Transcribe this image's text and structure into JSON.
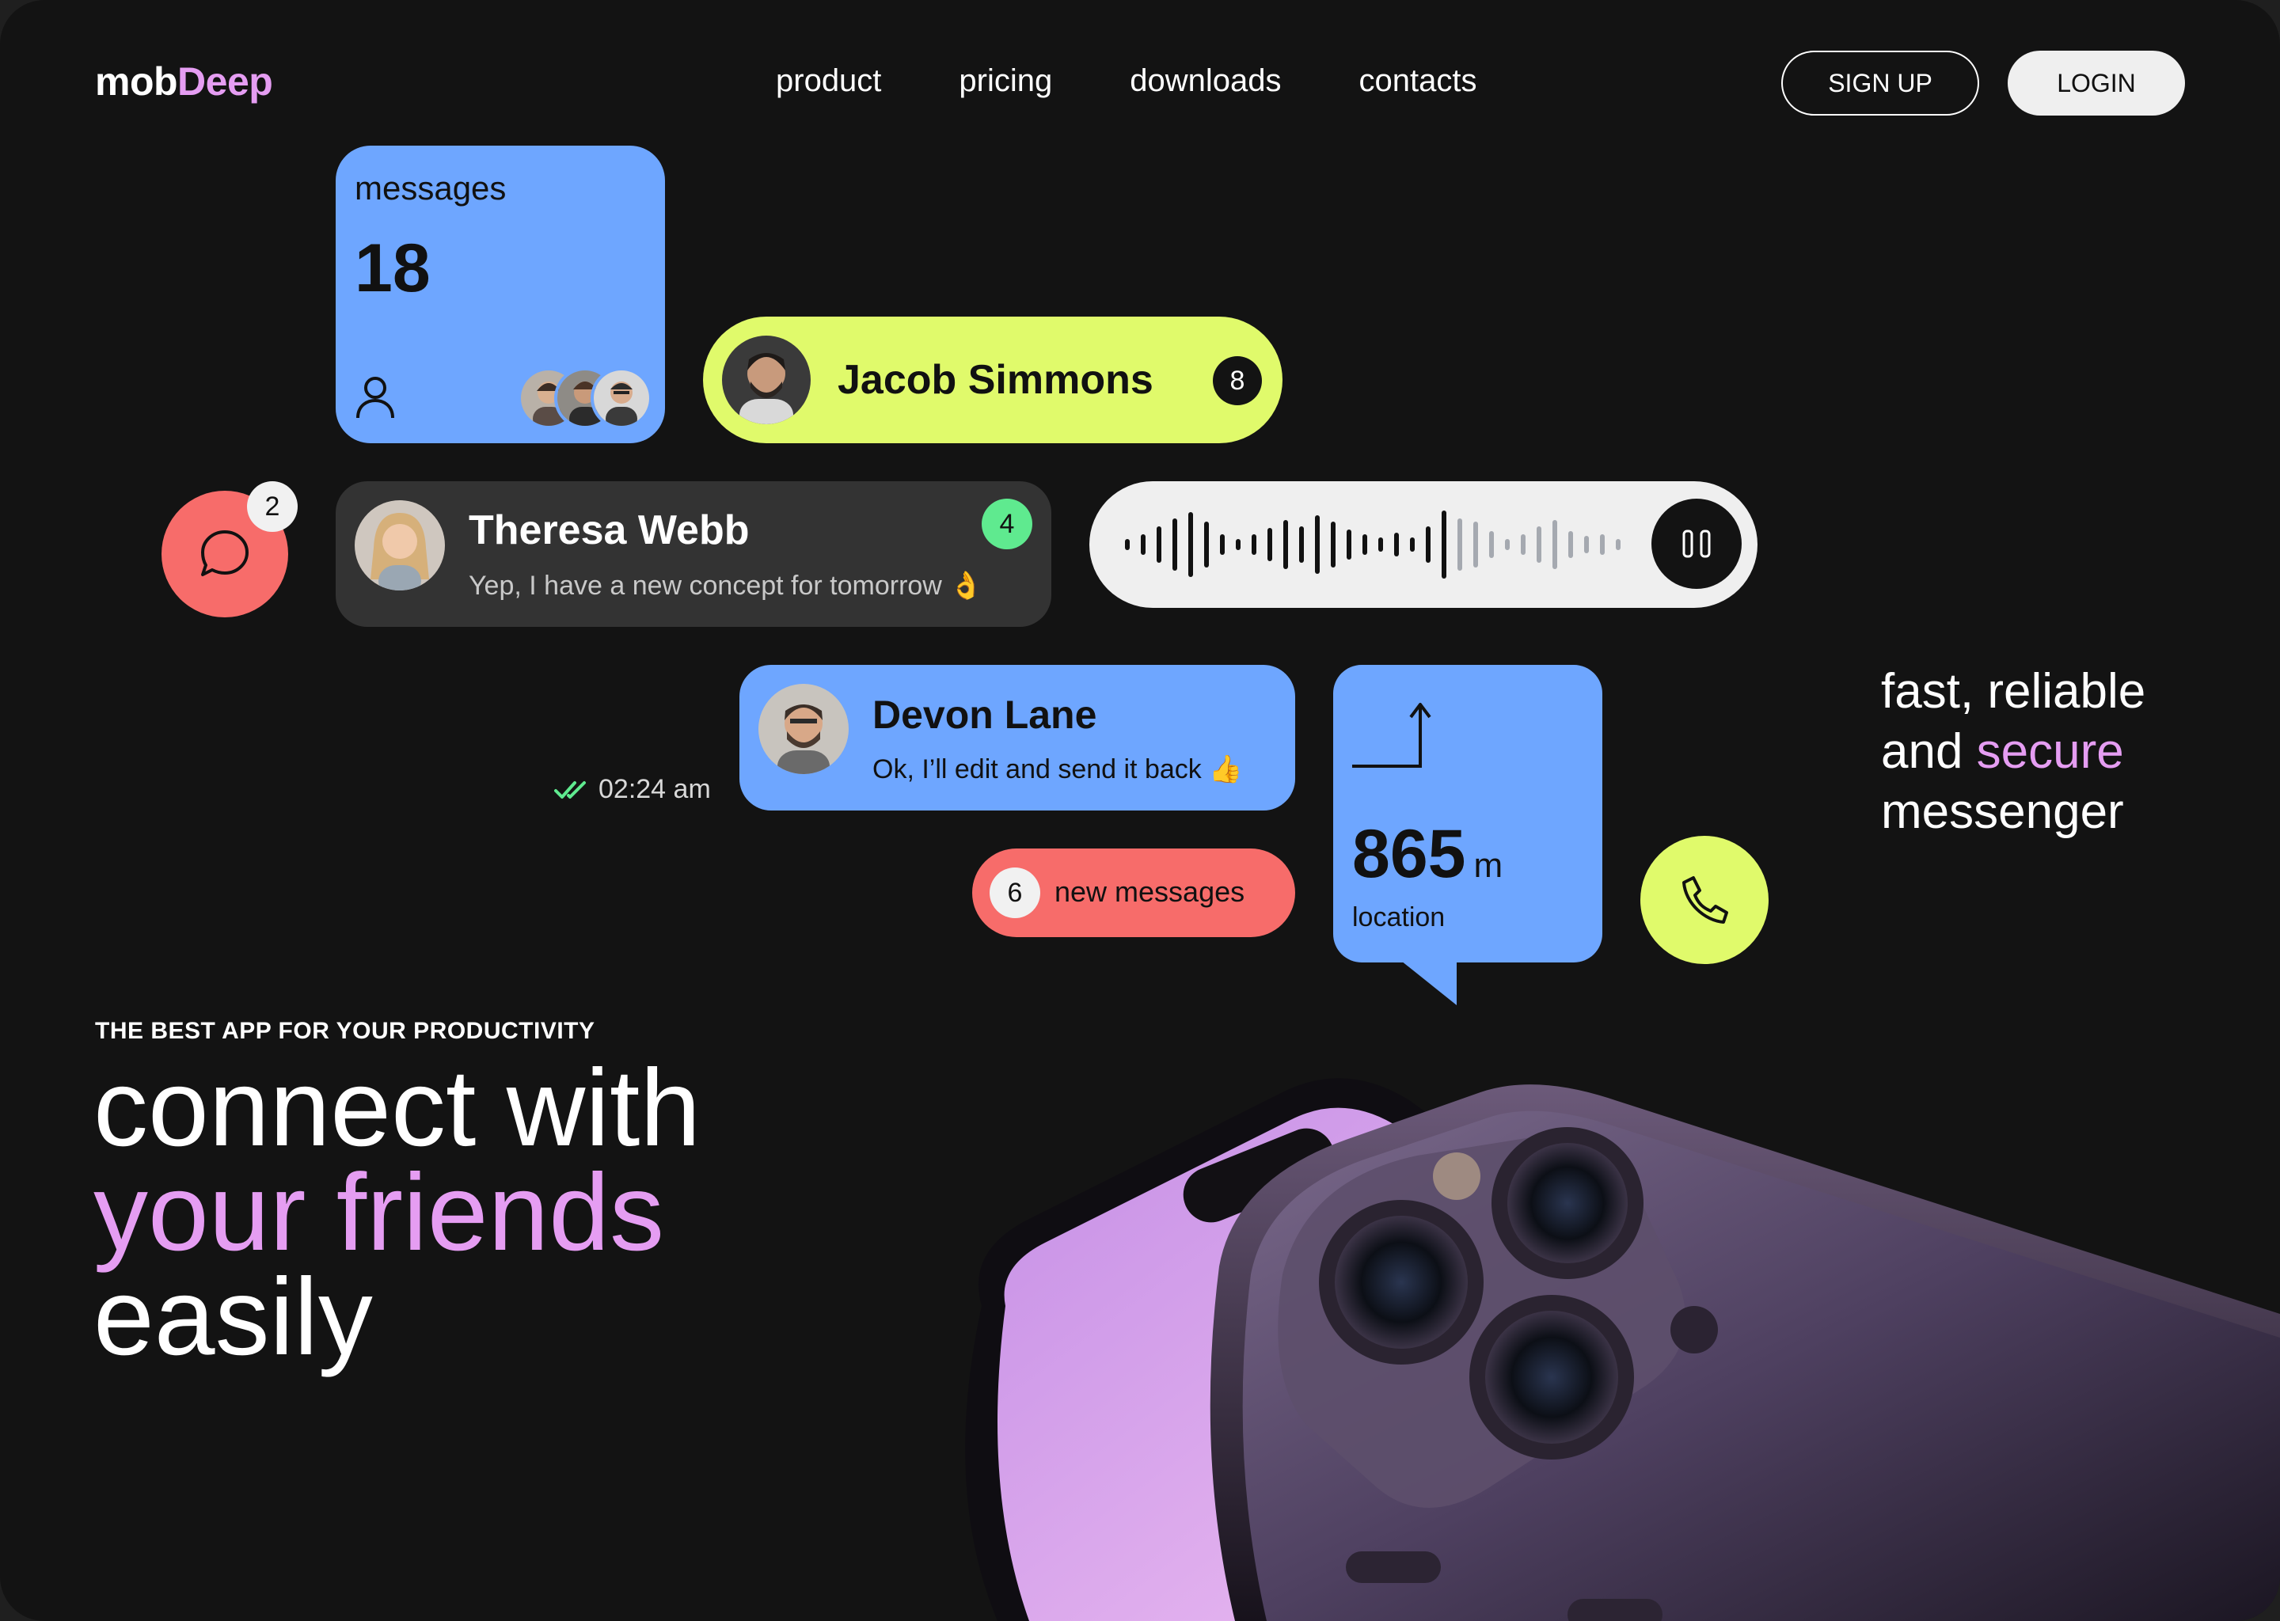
{
  "brand": {
    "name_a": "mob",
    "name_b": "Deep",
    "accent_color": "#e59df2"
  },
  "nav": [
    "product",
    "pricing",
    "downloads",
    "contacts"
  ],
  "auth": {
    "signup": "SIGN UP",
    "login": "LOGIN"
  },
  "messages_card": {
    "label": "messages",
    "count": "18"
  },
  "jacob": {
    "name": "Jacob Simmons",
    "badge": "8"
  },
  "chat_fab": {
    "badge": "2"
  },
  "theresa": {
    "name": "Theresa Webb",
    "message": "Yep, I have a new concept for tomorrow 👌",
    "badge": "4"
  },
  "voice": {
    "icon": "pause-icon"
  },
  "devon": {
    "name": "Devon Lane",
    "message": "Ok, I’ll edit and send it back 👍",
    "time": "02:24 am"
  },
  "new_messages": {
    "count": "6",
    "label": "new messages"
  },
  "location": {
    "distance": "865",
    "unit": "m",
    "label": "location"
  },
  "tagline": {
    "line1": "fast, reliable",
    "line2a": "and ",
    "line2b": "secure",
    "line3": "messenger"
  },
  "hero": {
    "eyebrow": "THE BEST APP FOR YOUR PRODUCTIVITY",
    "line1": "connect with",
    "line2": "your friends",
    "line3": "easily"
  },
  "colors": {
    "background": "#131313",
    "blue": "#6ea6ff",
    "lime": "#e0fa6b",
    "coral": "#f76c6a",
    "green": "#5fea8f"
  }
}
